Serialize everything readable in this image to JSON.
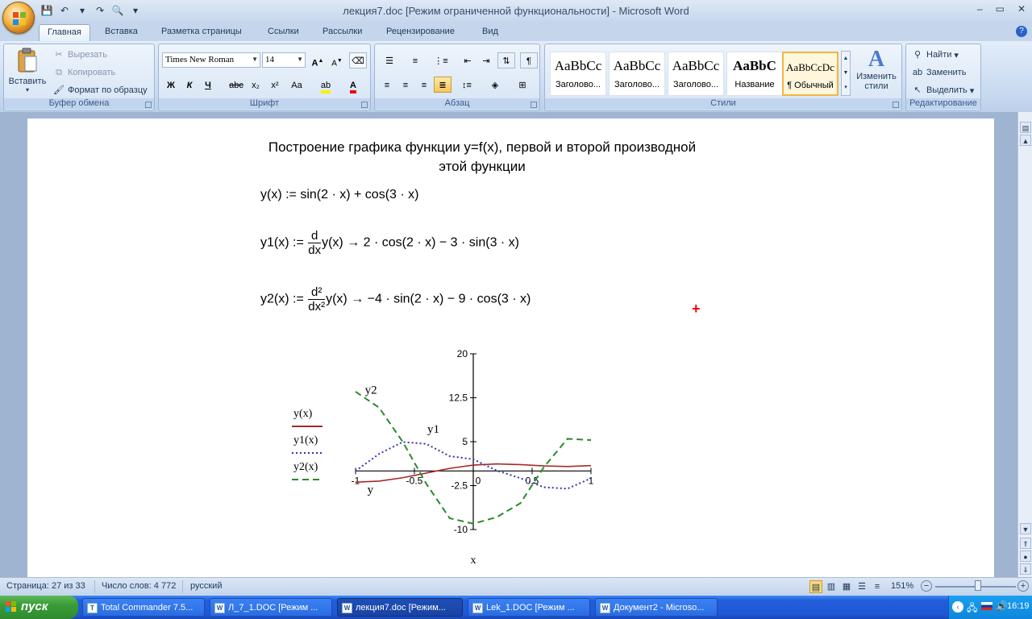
{
  "window": {
    "title_doc": "лекция7.doc [Режим ограниченной функциональности]",
    "title_sep": " - ",
    "title_app": "Microsoft Word",
    "controls": [
      "–",
      "▭",
      "✕"
    ]
  },
  "qat": [
    "💾",
    "↶",
    "▾",
    "↷",
    "🔍",
    "▾"
  ],
  "tabs": [
    {
      "label": "Главная",
      "active": true
    },
    {
      "label": "Вставка"
    },
    {
      "label": "Разметка страницы"
    },
    {
      "label": "Ссылки"
    },
    {
      "label": "Рассылки"
    },
    {
      "label": "Рецензирование"
    },
    {
      "label": "Вид"
    }
  ],
  "ribbon": {
    "clipboard": {
      "label": "Буфер обмена",
      "paste": "Вставить",
      "cut": "Вырезать",
      "copy": "Копировать",
      "format_painter": "Формат по образцу"
    },
    "font": {
      "label": "Шрифт",
      "family": "Times New Roman",
      "size": "14",
      "buttons": [
        "Ж",
        "К",
        "Ч",
        "abc",
        "x₂",
        "x²",
        "Aa"
      ]
    },
    "paragraph": {
      "label": "Абзац"
    },
    "styles": {
      "label": "Стили",
      "items": [
        {
          "sample": "AaBbCc",
          "name": "Заголово..."
        },
        {
          "sample": "AaBbCc",
          "name": "Заголово..."
        },
        {
          "sample": "AaBbCc",
          "name": "Заголово..."
        },
        {
          "sample": "AaBbC",
          "name": "Название"
        },
        {
          "sample": "AaBbCcDc",
          "name": "¶ Обычный",
          "selected": true
        }
      ],
      "change_styles": "Изменить стили"
    },
    "editing": {
      "label": "Редактирование",
      "find": "Найти",
      "replace": "Заменить",
      "select": "Выделить"
    }
  },
  "document": {
    "heading_line1": "Построение графика функции y=f(x), первой и второй производной",
    "heading_line2": "этой функции",
    "eq1": "y(x) := sin(2 · x) + cos(3 · x)",
    "eq2_lhs": "y1(x) :=",
    "eq2_num": "d",
    "eq2_den": "dx",
    "eq2_rhs": "y(x) → 2 · cos(2 · x) − 3 · sin(3 · x)",
    "eq3_lhs": "y2(x) :=",
    "eq3_num": "d²",
    "eq3_den": "dx²",
    "eq3_rhs": "y(x) → −4 · sin(2 · x) − 9 · cos(3 · x)"
  },
  "chart_data": {
    "type": "line",
    "xlabel": "x",
    "xlim": [
      -1,
      1
    ],
    "ylim": [
      -10,
      20
    ],
    "xticks": [
      "-1",
      "-0.5",
      "0",
      "0.5",
      "1"
    ],
    "yticks": [
      "20",
      "12.5",
      "5",
      "-2.5",
      "-10"
    ],
    "legend": [
      "y(x)",
      "y1(x)",
      "y2(x)"
    ],
    "annotations": [
      "y2",
      "y1",
      "y"
    ],
    "series": [
      {
        "name": "y(x)",
        "color": "#a52a2a",
        "style": "solid",
        "x": [
          -1,
          -0.8,
          -0.6,
          -0.4,
          -0.2,
          0,
          0.2,
          0.4,
          0.6,
          0.8,
          1
        ],
        "y": [
          -1.9,
          -1.74,
          -1.16,
          -0.36,
          0.44,
          1.0,
          1.21,
          1.08,
          0.86,
          0.76,
          0.92
        ]
      },
      {
        "name": "y1(x)",
        "color": "#3333aa",
        "style": "dotted",
        "x": [
          -1,
          -0.8,
          -0.6,
          -0.4,
          -0.2,
          0,
          0.2,
          0.4,
          0.6,
          0.8,
          1
        ],
        "y": [
          -0.0,
          2.92,
          4.94,
          4.63,
          2.53,
          2.0,
          0.06,
          -1.23,
          -2.78,
          -3.03,
          -1.25
        ]
      },
      {
        "name": "y2(x)",
        "color": "#2a8a2a",
        "style": "dashed",
        "x": [
          -1,
          -0.8,
          -0.6,
          -0.4,
          -0.2,
          0,
          0.2,
          0.4,
          0.6,
          0.8,
          1
        ],
        "y": [
          13.54,
          10.82,
          5.0,
          -2.15,
          -8.07,
          -9.0,
          -7.88,
          -5.51,
          0.66,
          5.49,
          5.28
        ]
      }
    ]
  },
  "status": {
    "page": "Страница: 27 из 33",
    "words": "Число слов: 4 772",
    "lang": "русский",
    "zoom": "151%"
  },
  "taskbar": {
    "start": "пуск",
    "tasks": [
      {
        "label": "Total Commander 7.5...",
        "icon": "T"
      },
      {
        "label": "Л_7_1.DOC [Режим ...",
        "icon": "W"
      },
      {
        "label": "лекция7.doc [Режим...",
        "icon": "W",
        "active": true
      },
      {
        "label": "Lek_1.DOC [Режим ...",
        "icon": "W"
      },
      {
        "label": "Документ2 - Microso...",
        "icon": "W"
      }
    ],
    "clock": "16:19"
  }
}
